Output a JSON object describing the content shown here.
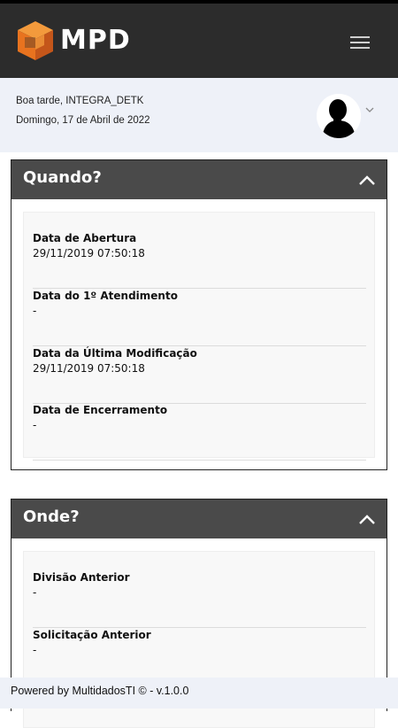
{
  "app": {
    "brand": "MPD"
  },
  "header": {
    "logo_icon": "cube-logo-icon",
    "menu_icon": "hamburger-menu-icon"
  },
  "user": {
    "greeting": "Boa tarde, INTEGRA_DETK",
    "date": "Domingo, 17 de Abril de 2022",
    "avatar_icon": "user-avatar-icon",
    "dropdown_icon": "chevron-down-icon"
  },
  "sections": [
    {
      "title": "Quando?",
      "toggle_icon": "chevron-up-icon",
      "fields": [
        {
          "label": "Data de Abertura",
          "value": "29/11/2019 07:50:18"
        },
        {
          "label": "Data do 1º Atendimento",
          "value": "-"
        },
        {
          "label": "Data da Última Modificação",
          "value": "29/11/2019 07:50:18"
        },
        {
          "label": "Data de Encerramento",
          "value": "-"
        }
      ]
    },
    {
      "title": "Onde?",
      "toggle_icon": "chevron-up-icon",
      "fields": [
        {
          "label": "Divisão Anterior",
          "value": "-"
        },
        {
          "label": "Solicitação Anterior",
          "value": "-"
        }
      ]
    }
  ],
  "footer": {
    "text": "Powered by MultidadosTI © - v.1.0.0"
  },
  "colors": {
    "topbar": "#2c2c2c",
    "panel_header": "#4a4a4a",
    "userbar": "#eef1f8",
    "logo_orange": "#e8731f"
  }
}
